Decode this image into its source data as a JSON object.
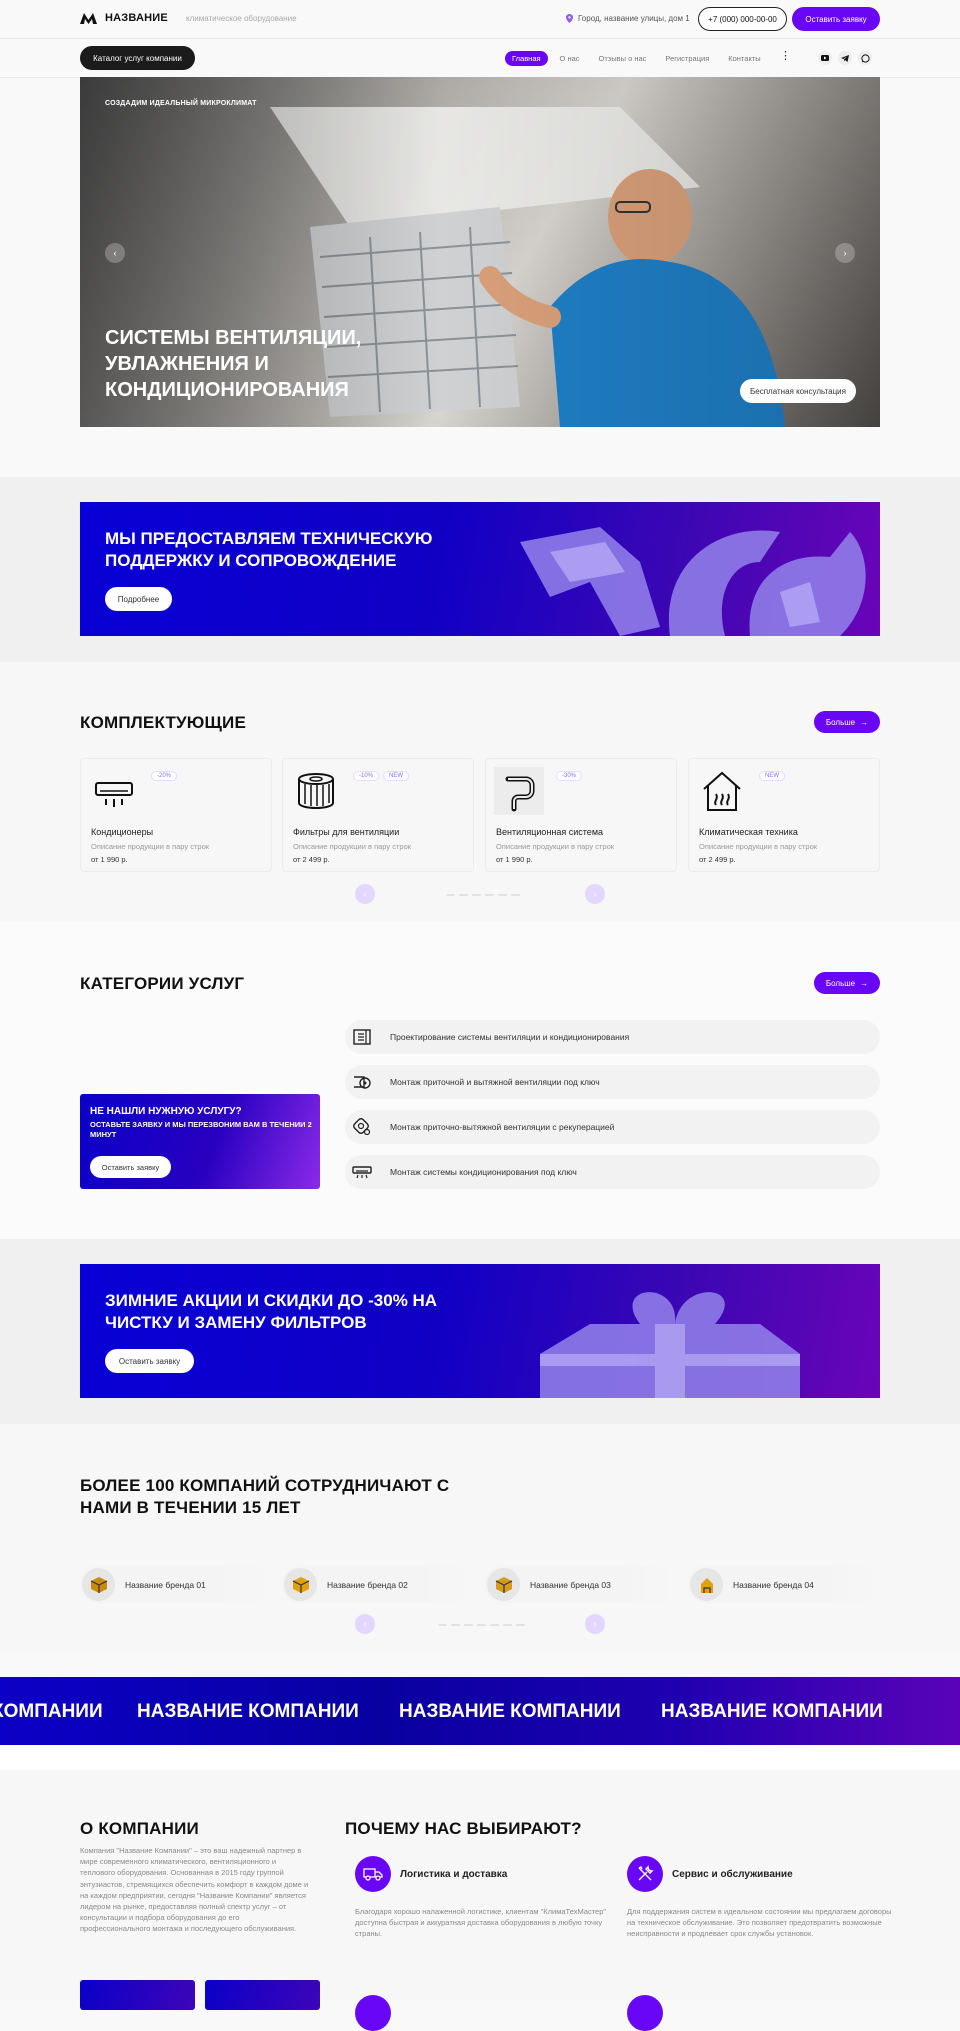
{
  "header": {
    "logo_text": "НАЗВАНИЕ",
    "tagline": "климатическое оборудование",
    "address": "Город, название улицы, дом 1",
    "phone": "+7 (000) 000-00-00",
    "request_button": "Оставить заявку"
  },
  "nav": {
    "catalog_button": "Каталог услуг компании",
    "links": [
      "Главная",
      "О нас",
      "Отзывы о нас",
      "Регистрация",
      "Контакты"
    ],
    "more_icon": "more-vertical-icon",
    "social": [
      "youtube-icon",
      "telegram-icon",
      "whatsapp-icon"
    ]
  },
  "hero": {
    "eyebrow": "СОЗДАДИМ ИДЕАЛЬНЫЙ МИКРОКЛИМАТ",
    "title": "СИСТЕМЫ ВЕНТИЛЯЦИИ, УВЛАЖНЕНИЯ И КОНДИЦИОНИРОВАНИЯ",
    "cta": "Бесплатная консультация"
  },
  "support_banner": {
    "title": "МЫ ПРЕДОСТАВЛЯЕМ ТЕХНИЧЕСКУЮ ПОДДЕРЖКУ И СОПРОВОЖДЕНИЕ",
    "button": "Подробнее"
  },
  "components": {
    "title": "КОМПЛЕКТУЮЩИЕ",
    "more_button": "Больше",
    "items": [
      {
        "name": "Кондиционеры",
        "desc": "Описание продукции в пару строк",
        "price": "от 1 990 р.",
        "badges": [
          "-20%"
        ],
        "icon": "air-conditioner-icon"
      },
      {
        "name": "Фильтры для вентиляции",
        "desc": "Описание продукции в пару строк",
        "price": "от 2 499 р.",
        "badges": [
          "-10%",
          "NEW"
        ],
        "icon": "filter-icon"
      },
      {
        "name": "Вентиляционная система",
        "desc": "Описание продукции в пару строк",
        "price": "от 1 990 р.",
        "badges": [
          "-30%"
        ],
        "icon": "ventilation-pipe-icon"
      },
      {
        "name": "Климатическая техника",
        "desc": "Описание продукции в пару строк",
        "price": "от 2 499 р.",
        "badges": [
          "NEW"
        ],
        "icon": "heating-house-icon"
      }
    ]
  },
  "services": {
    "title": "КАТЕГОРИИ УСЛУГ",
    "more_button": "Больше",
    "promo": {
      "title": "НЕ НАШЛИ НУЖНУЮ УСЛУГУ?",
      "subtitle": "ОСТАВЬТЕ ЗАЯВКУ И МЫ ПЕРЕЗВОНИМ ВАМ В ТЕЧЕНИИ 2 МИНУТ",
      "button": "Оставить заявку"
    },
    "items": [
      {
        "label": "Проектирование системы вентиляции и кондиционирования",
        "icon": "blueprint-icon"
      },
      {
        "label": "Монтаж приточной и вытяжной вентиляции под ключ",
        "icon": "fan-icon"
      },
      {
        "label": "Монтаж приточно-вытяжной вентиляции с рекуперацией",
        "icon": "recuperator-icon"
      },
      {
        "label": "Монтаж системы кондиционирования под ключ",
        "icon": "ac-unit-icon"
      }
    ]
  },
  "promo_banner": {
    "title": "ЗИМНИЕ АКЦИИ И СКИДКИ ДО -30% НА ЧИСТКУ И ЗАМЕНУ ФИЛЬТРОВ",
    "button": "Оставить заявку"
  },
  "partners": {
    "title": "БОЛЕЕ 100 КОМПАНИЙ СОТРУДНИЧАЮТ С НАМИ В ТЕЧЕНИИ 15 ЛЕТ",
    "brands": [
      "Название бренда 01",
      "Название бренда 02",
      "Название бренда 03",
      "Название бренда 04"
    ]
  },
  "marquee": {
    "items": [
      "КОМПАНИИ",
      "НАЗВАНИЕ КОМПАНИИ",
      "НАЗВАНИЕ КОМПАНИИ",
      "НАЗВАНИЕ КОМПАНИИ"
    ]
  },
  "about": {
    "title": "О КОМПАНИИ",
    "text": "Компания \"Название Компании\" – это ваш надежный партнер в мире современного климатического, вентиляционного и теплового оборудования. Основанная в 2015 году группой энтузиастов, стремящихся обеспечить комфорт в каждом доме и на каждом предприятии, сегодня \"Название Компании\" является лидером на рынке, предоставляя полный спектр услуг – от консультации и подбора оборудования до его профессионального монтажа и последующего обслуживания."
  },
  "why": {
    "title": "ПОЧЕМУ НАС ВЫБИРАЮТ?",
    "items": [
      {
        "title": "Логистика и доставка",
        "text": "Благодаря хорошо налаженной логистике, клиентам \"КлимаТехМастер\" доступна быстрая и аккуратная доставка оборудования в любую точку страны.",
        "icon": "truck-icon"
      },
      {
        "title": "Сервис и обслуживание",
        "text": "Для поддержания систем в идеальном состоянии мы предлагаем договоры на техническое обслуживание. Это позволяет предотвратить возможные неисправности и продлевает срок службы установок.",
        "icon": "tools-icon"
      }
    ]
  },
  "colors": {
    "accent": "#6a06f6",
    "dark": "#1b1b1b",
    "banner_start": "#0800d6",
    "banner_end": "#6a04b8"
  }
}
